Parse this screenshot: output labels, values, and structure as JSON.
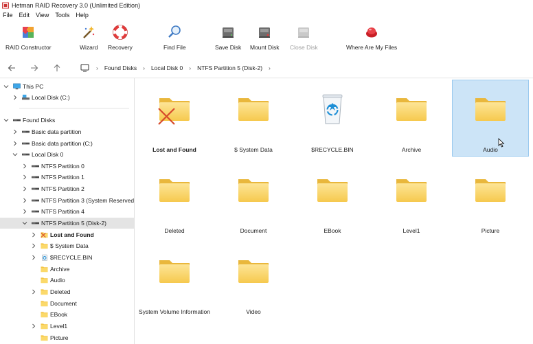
{
  "window": {
    "title": "Hetman RAID Recovery 3.0 (Unlimited Edition)",
    "app_icon": "hetman-app-icon"
  },
  "menu": [
    "File",
    "Edit",
    "View",
    "Tools",
    "Help"
  ],
  "toolbar": {
    "raid_constructor": "RAID Constructor",
    "wizard": "Wizard",
    "recovery": "Recovery",
    "find_file": "Find File",
    "save_disk": "Save Disk",
    "mount_disk": "Mount Disk",
    "close_disk": "Close Disk",
    "where_are_my_files": "Where Are My Files"
  },
  "breadcrumb": [
    "Found Disks",
    "Local Disk 0",
    "NTFS Partition 5 (Disk-2)"
  ],
  "tree": {
    "this_pc": "This PC",
    "local_disk_c": "Local Disk (C:)",
    "found_disks": "Found Disks",
    "basic_data_partition": "Basic data partition",
    "basic_data_partition_c": "Basic data partition (C:)",
    "local_disk_0": "Local Disk 0",
    "ntfs_0": "NTFS Partition 0",
    "ntfs_1": "NTFS Partition 1",
    "ntfs_2": "NTFS Partition 2",
    "ntfs_3": "NTFS Partition 3 (System Reserved)",
    "ntfs_4": "NTFS Partition 4",
    "ntfs_5": "NTFS Partition 5 (Disk-2)",
    "lost_and_found": "Lost and Found",
    "system_data": "$ System Data",
    "recycle_bin": "$RECYCLE.BIN",
    "archive": "Archive",
    "audio": "Audio",
    "deleted": "Deleted",
    "document": "Document",
    "ebook": "EBook",
    "level1": "Level1",
    "picture": "Picture"
  },
  "items": [
    {
      "label": "Lost and Found",
      "icon": "folder-deleted-icon"
    },
    {
      "label": "$ System Data",
      "icon": "folder-icon"
    },
    {
      "label": "$RECYCLE.BIN",
      "icon": "recycle-bin-icon"
    },
    {
      "label": "Archive",
      "icon": "folder-icon"
    },
    {
      "label": "Audio",
      "icon": "folder-icon",
      "selected": true
    },
    {
      "label": "Deleted",
      "icon": "folder-icon"
    },
    {
      "label": "Document",
      "icon": "folder-icon"
    },
    {
      "label": "EBook",
      "icon": "folder-icon"
    },
    {
      "label": "Level1",
      "icon": "folder-icon"
    },
    {
      "label": "Picture",
      "icon": "folder-icon"
    },
    {
      "label": "System Volume Information",
      "icon": "folder-icon"
    },
    {
      "label": "Video",
      "icon": "folder-icon"
    }
  ],
  "colors": {
    "selection": "#cce4f7",
    "selection_border": "#99c9ef",
    "folder": "#f9d36a",
    "tree_selected": "#e4e4e4"
  }
}
